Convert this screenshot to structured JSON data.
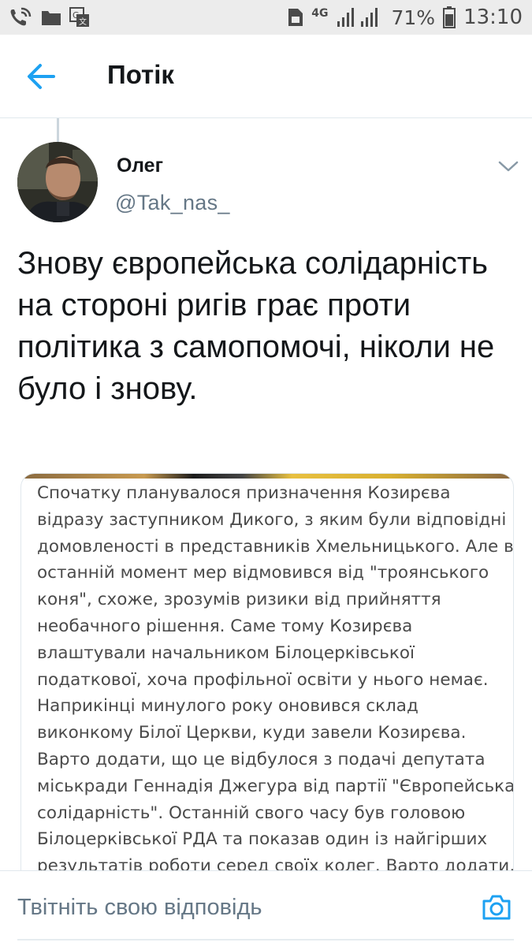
{
  "status_bar": {
    "network": "4G",
    "battery": "71%",
    "time": "13:10"
  },
  "header": {
    "title": "Потік"
  },
  "tweet": {
    "author_name": "Олег",
    "author_handle": "@Tak_nas_",
    "text": "Знову європейська солідарність на стороні ригів грає проти політика з самопомочі, ніколи не було і знову.",
    "media_text_lines": [
      "Спочатку планувалося призначення Козирєва",
      "відразу заступником Дикого, з яким були відповідні",
      "домовленості в представників Хмельницького. Але в",
      "останній момент мер відмовився від \"троянського",
      "коня\", схоже, зрозумів ризики від прийняття",
      "необачного рішення. Саме тому Козирєва",
      "влаштували начальником Білоцерківської",
      "податкової, хоча профільної освіти у нього немає.",
      "Наприкінці минулого року оновився склад",
      "виконкому Білої Церкви, куди завели Козирєва.",
      "Варто додати, що це відбулося з подачі депутата",
      "міськради Геннадія Джегура від партії \"Європейська",
      "солідарність\". Останній свого часу був головою",
      "Білоцерківської РДА та показав один із найгірших",
      "результатів роботи серед своїх колег. Варто додати,"
    ]
  },
  "reply": {
    "placeholder": "Твітніть свою відповідь"
  },
  "colors": {
    "accent": "#1da1f2",
    "text_primary": "#14171a",
    "text_secondary": "#657786",
    "divider": "#e1e8ed"
  },
  "icons": [
    "phone-wifi-icon",
    "folder-icon",
    "translate-icon",
    "sim-icon",
    "signal-icon",
    "battery-icon",
    "back-arrow-icon",
    "chevron-down-icon",
    "camera-icon"
  ]
}
